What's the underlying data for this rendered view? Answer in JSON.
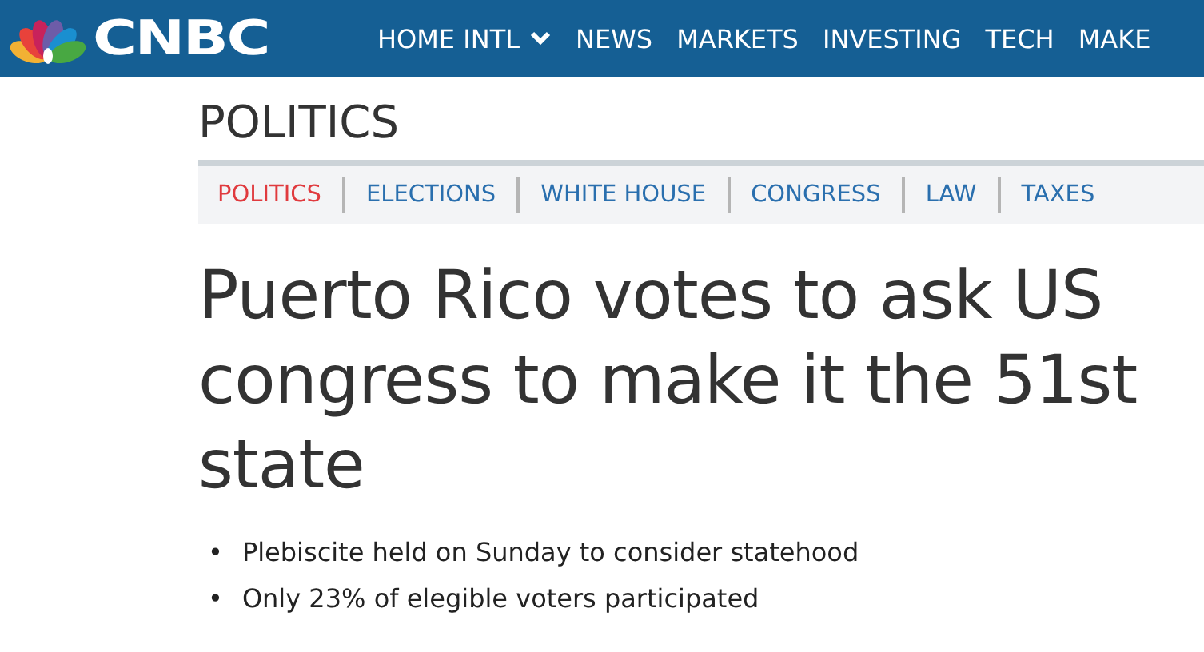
{
  "header": {
    "logo": "CNBC",
    "nav": [
      {
        "label": "HOME INTL",
        "dropdown": true
      },
      {
        "label": "NEWS",
        "dropdown": false
      },
      {
        "label": "MARKETS",
        "dropdown": false
      },
      {
        "label": "INVESTING",
        "dropdown": false
      },
      {
        "label": "TECH",
        "dropdown": false
      },
      {
        "label": "MAKE",
        "dropdown": false
      }
    ]
  },
  "section": {
    "title": "POLITICS",
    "subnav": [
      {
        "label": "POLITICS",
        "selected": true
      },
      {
        "label": "ELECTIONS",
        "selected": false
      },
      {
        "label": "WHITE HOUSE",
        "selected": false
      },
      {
        "label": "CONGRESS",
        "selected": false
      },
      {
        "label": "LAW",
        "selected": false
      },
      {
        "label": "TAXES",
        "selected": false
      }
    ]
  },
  "article": {
    "headline": "Puerto Rico votes to ask US congress to make it the 51st state",
    "bullets": [
      {
        "marker": "•",
        "text": "Plebiscite held on Sunday to consider statehood"
      },
      {
        "marker": "•",
        "text": "Only 23% of elegible voters participated"
      }
    ]
  }
}
